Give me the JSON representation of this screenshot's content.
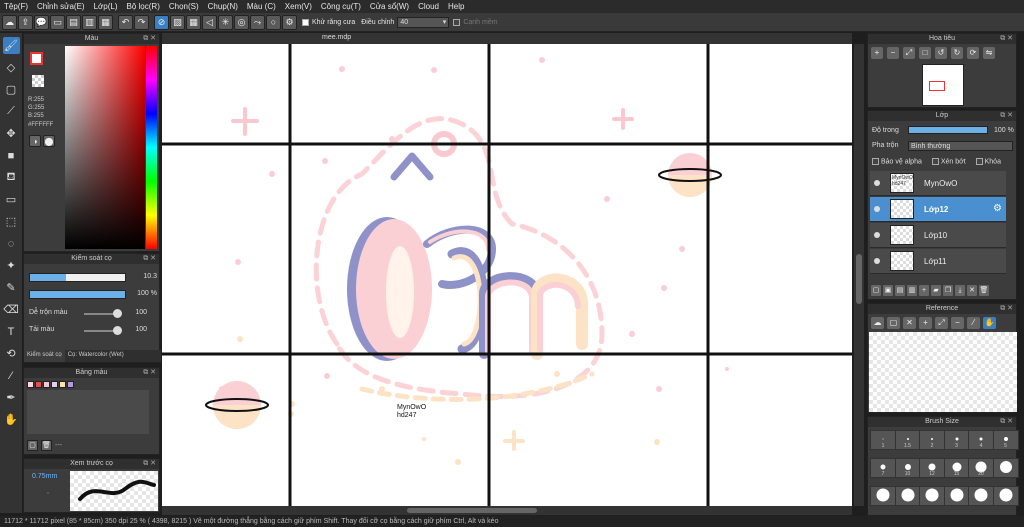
{
  "menu": [
    "Tệp(F)",
    "Chỉnh sửa(E)",
    "Lớp(L)",
    "Bộ lọc(R)",
    "Chọn(S)",
    "Chụp(N)",
    "Màu (C)",
    "Xem(V)",
    "Công cụ(T)",
    "Cửa sổ(W)",
    "Cloud",
    "Help"
  ],
  "toolbar": {
    "antialias_label": "Khử răng cưa",
    "smooth_label": "Điều chỉnh",
    "smooth_value": "40",
    "edge_label": "Cạnh mềm"
  },
  "color_panel": {
    "title": "Màu",
    "r": "R:255",
    "g": "G:255",
    "b": "B:255",
    "hex": "#FFFFFF"
  },
  "brush_panel": {
    "title": "Kiểm soát cọ",
    "size_value": "10.3",
    "size_fraction": 0.38,
    "opacity_value": "100 %",
    "opacity_fraction": 1.0,
    "blend_label": "Dễ trộn màu",
    "blend_value": "100",
    "mix_label": "Tải màu",
    "mix_value": "100",
    "tab_active": "Kiểm soát cọ",
    "tab_other": "Cọ: Watercolor (Wet)"
  },
  "palette_panel": {
    "title": "Bảng màu",
    "swatches": [
      "#ffd6de",
      "#e84c4c",
      "#f7c6d0",
      "#d9d2f0",
      "#ffe3a8",
      "#b29be0"
    ],
    "dash_text": "---"
  },
  "preview_panel": {
    "title": "Xem trước cọ",
    "size_text": "0.75mm"
  },
  "document": {
    "tab_title": "mee.mdp",
    "watermark_line1": "MynOwO",
    "watermark_line2": "hd247"
  },
  "statusbar": {
    "text": "11712 * 11712 pixel  (85 * 85cm)  350 dpi  25 %  ( 4398, 8215 )  Vẽ một đường thẳng bằng cách giữ phím Shift. Thay đổi cỡ cọ bằng cách giữ phím Ctrl, Alt và kéo"
  },
  "nav_panel": {
    "title": "Hoa tiêu"
  },
  "layer_panel": {
    "title": "Lớp",
    "opacity_label": "Độ trong",
    "opacity_value": "100 %",
    "blend_label": "Pha trộn",
    "blend_value": "Bình thường",
    "protect_alpha": "Bảo vệ alpha",
    "clipping": "Xén bớt",
    "lock": "Khóa",
    "layers": [
      {
        "name": "MynOwO",
        "thumb": "MynOwO hd247",
        "selected": false
      },
      {
        "name": "Lớp12",
        "thumb": "",
        "selected": true
      },
      {
        "name": "Lớp10",
        "thumb": "",
        "selected": false
      },
      {
        "name": "Lớp11",
        "thumb": "",
        "selected": false
      }
    ]
  },
  "ref_panel": {
    "title": "Reference"
  },
  "size_panel": {
    "title": "Brush Size",
    "sizes": [
      "1",
      "1.5",
      "2",
      "3",
      "4",
      "5",
      "7",
      "10",
      "12",
      "15",
      "20",
      "",
      "",
      "",
      "",
      "",
      "",
      ""
    ]
  },
  "colors": {
    "accent": "#3a7fc4",
    "pink": "#f9c9cf",
    "peach": "#fde3c6",
    "lavender": "#8f92c9"
  }
}
